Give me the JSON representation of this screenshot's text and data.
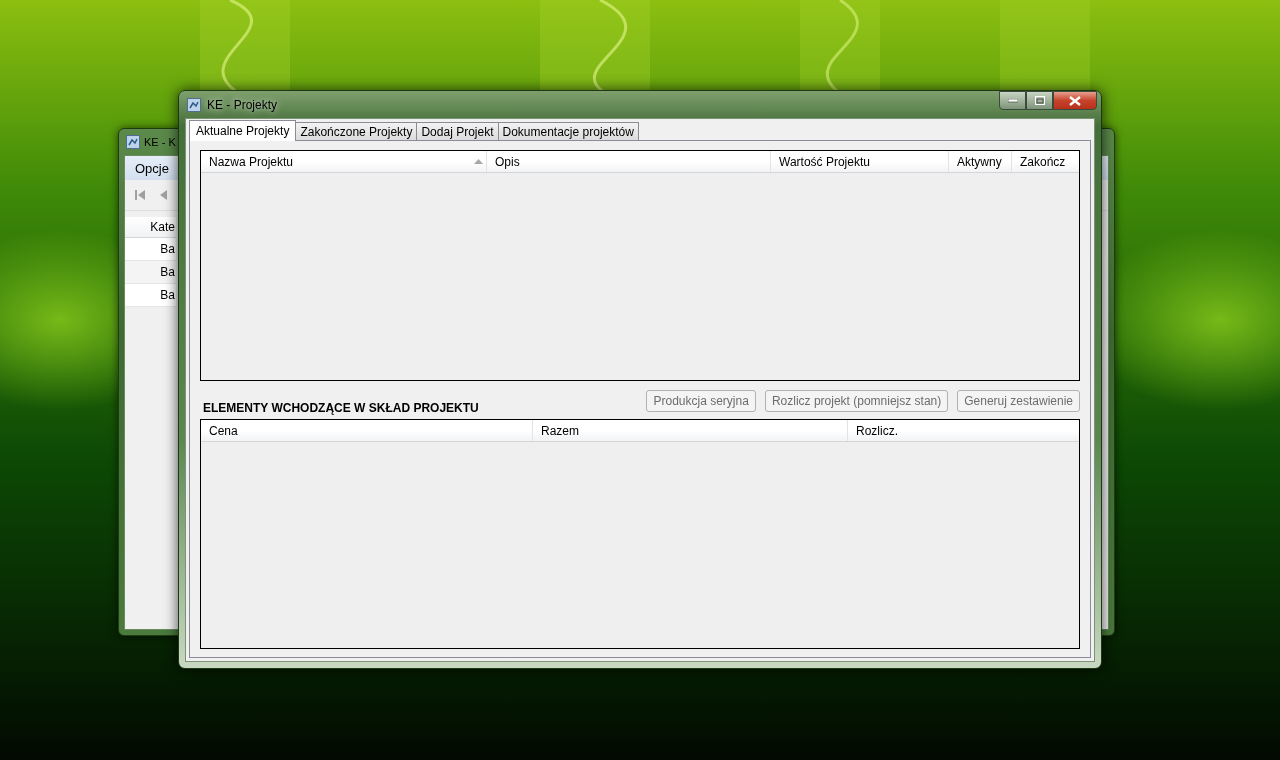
{
  "background_window": {
    "title": "KE - K",
    "menu": [
      "Opcje"
    ],
    "table": {
      "columns": [
        "Kate"
      ],
      "rows": [
        "Ba",
        "Ba",
        "Ba"
      ]
    }
  },
  "window": {
    "title": "KE - Projekty"
  },
  "tabs": [
    {
      "label": "Aktualne Projekty",
      "selected": true
    },
    {
      "label": "Zakończone Projekty",
      "selected": false
    },
    {
      "label": "Dodaj Projekt",
      "selected": false
    },
    {
      "label": "Dokumentacje projektów",
      "selected": false
    }
  ],
  "projects_table": {
    "columns": [
      {
        "label": "Nazwa Projektu",
        "sorted_ascending": true
      },
      {
        "label": "Opis"
      },
      {
        "label": "Wartość Projektu"
      },
      {
        "label": "Aktywny"
      },
      {
        "label": "Zakończ"
      }
    ]
  },
  "section_title": "ELEMENTY WCHODZĄCE W SKŁAD PROJEKTU",
  "buttons": [
    {
      "label": "Produkcja seryjna",
      "disabled": true
    },
    {
      "label": "Rozlicz projekt (pomniejsz stan)",
      "disabled": true
    },
    {
      "label": "Generuj zestawienie",
      "disabled": true
    }
  ],
  "elements_table": {
    "columns": [
      "Cena",
      "Razem",
      "Rozlicz."
    ]
  }
}
